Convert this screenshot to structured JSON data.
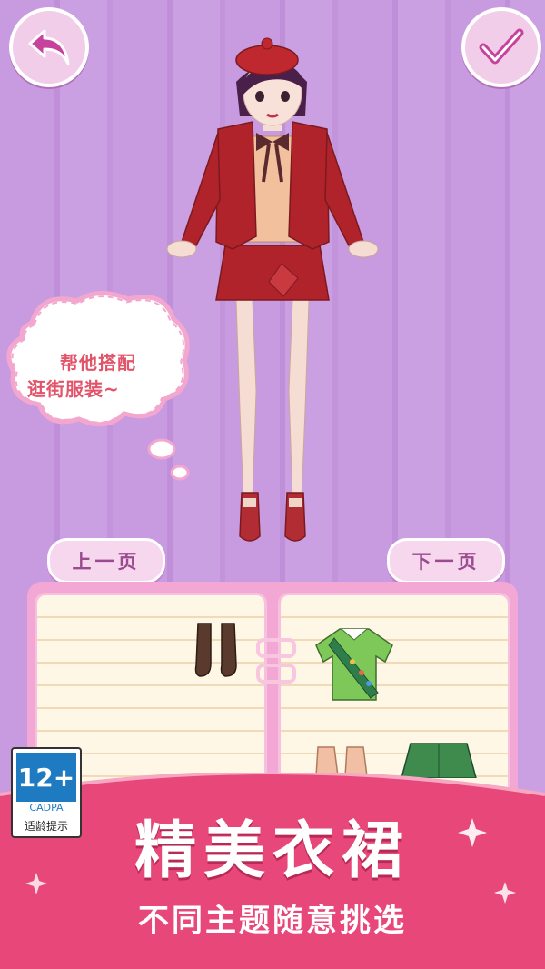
{
  "header": {
    "back_icon": "back-arrow-icon",
    "confirm_icon": "checkmark-icon"
  },
  "speech_bubble": {
    "line1": "帮他搭配",
    "line2": "逛街服装~"
  },
  "pager": {
    "prev_label": "上一页",
    "next_label": "下一页"
  },
  "closet": {
    "items": [
      {
        "name": "brown-boots",
        "color": "#5b3a2e"
      },
      {
        "name": "green-scout-shirt",
        "color": "#7ec85a"
      },
      {
        "name": "pink-sneakers",
        "color": "#f1bfa3"
      },
      {
        "name": "green-shorts",
        "color": "#3f8a4d"
      }
    ]
  },
  "age_rating": {
    "age": "12+",
    "brand": "CADPA",
    "tip": "适龄提示"
  },
  "promo": {
    "title": "精美衣裙",
    "subtitle": "不同主题随意挑选"
  },
  "colors": {
    "background": "#c89ae0",
    "banner": "#e8477a",
    "accent_pink": "#f3a7d4",
    "outfit_red": "#b0232b"
  }
}
